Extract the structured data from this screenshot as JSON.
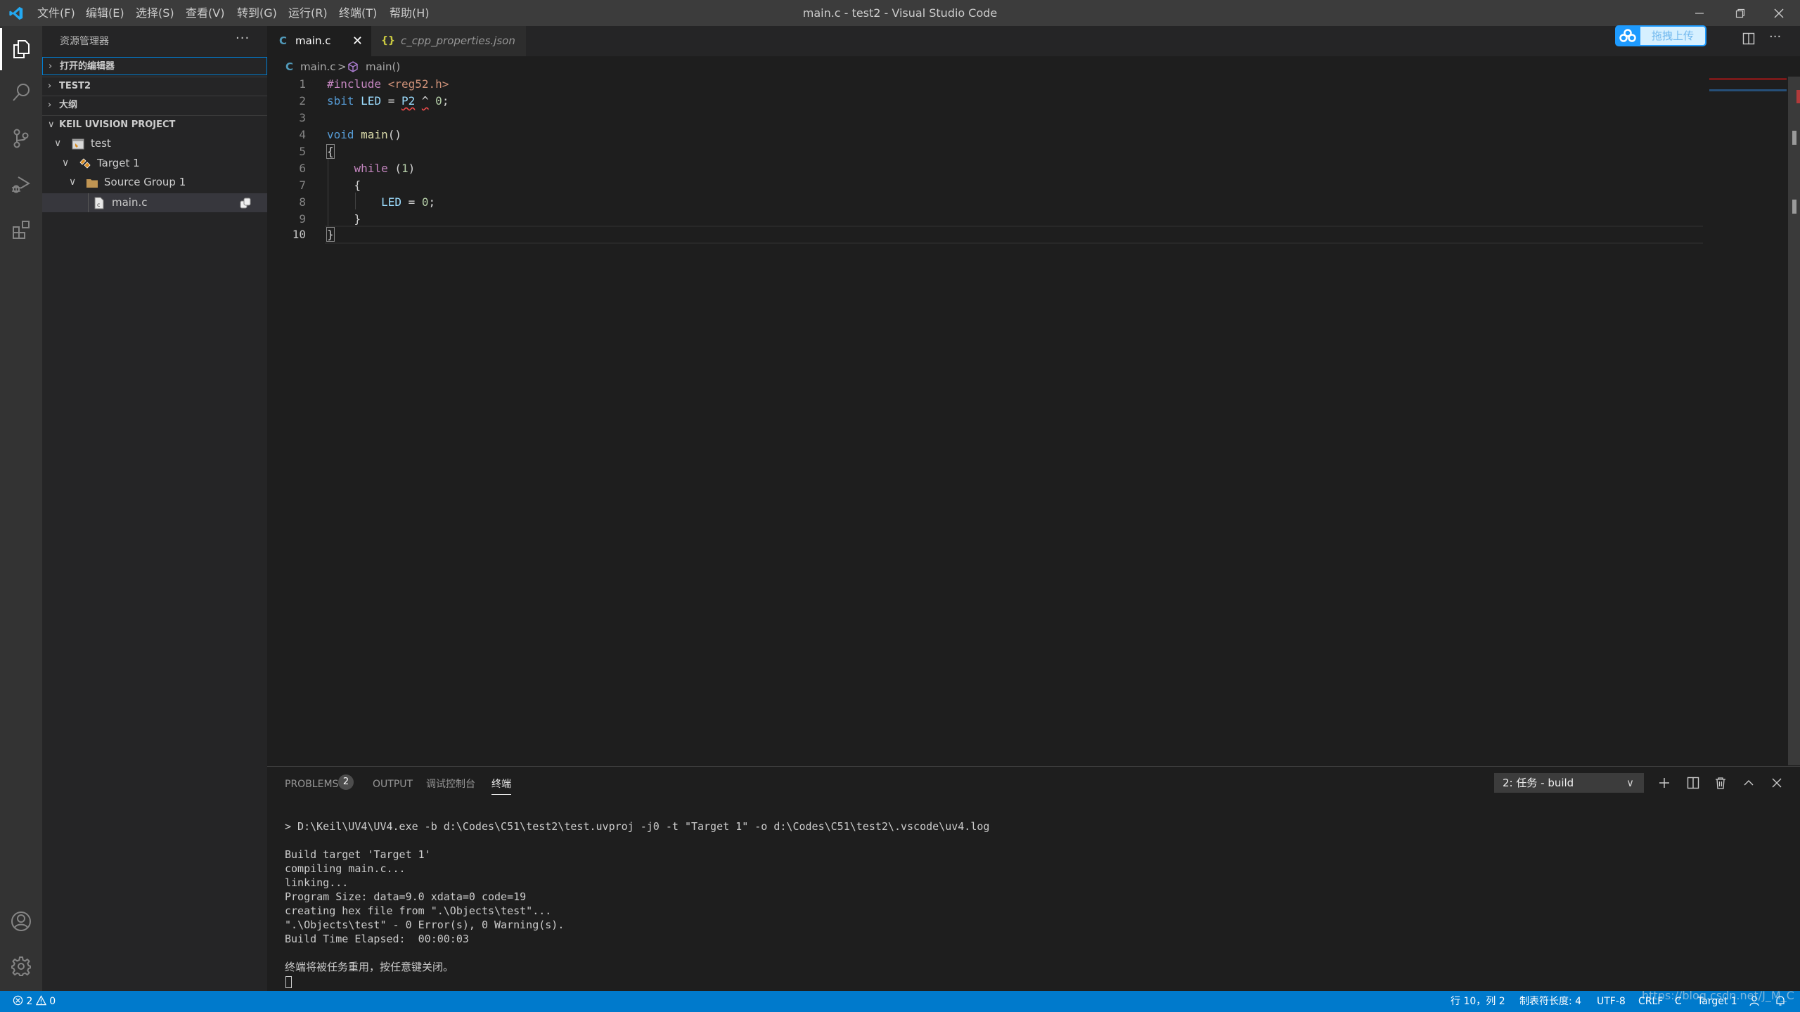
{
  "titlebar": {
    "title": "main.c - test2 - Visual Studio Code",
    "menu": [
      "文件(F)",
      "编辑(E)",
      "选择(S)",
      "查看(V)",
      "转到(G)",
      "运行(R)",
      "终端(T)",
      "帮助(H)"
    ]
  },
  "activitybar": {
    "items": [
      "explorer-icon",
      "search-icon",
      "source-control-icon",
      "run-debug-icon",
      "extensions-icon"
    ],
    "bottom": [
      "account-icon",
      "settings-gear-icon"
    ]
  },
  "sidebar": {
    "title": "资源管理器",
    "more": "···",
    "sections": [
      {
        "label": "打开的编辑器",
        "expanded": false
      },
      {
        "label": "TEST2",
        "expanded": false
      },
      {
        "label": "大纲",
        "expanded": false
      },
      {
        "label": "KEIL UVISION PROJECT",
        "expanded": true
      }
    ],
    "tree": [
      {
        "label": "test",
        "kind": "project"
      },
      {
        "label": "Target 1",
        "kind": "target"
      },
      {
        "label": "Source Group 1",
        "kind": "folder"
      },
      {
        "label": "main.c",
        "kind": "file",
        "selected": true
      }
    ]
  },
  "editor": {
    "tabs": [
      {
        "label": "main.c",
        "icon": "C",
        "active": true,
        "close": "✕"
      },
      {
        "label": "c_cpp_properties.json",
        "icon": "{}",
        "active": false
      }
    ],
    "upload_button": "拖拽上传",
    "breadcrumb": {
      "icon": "C",
      "file": "main.c",
      "separator": ">",
      "symbol": "main()"
    },
    "line_numbers": [
      "1",
      "2",
      "3",
      "4",
      "5",
      "6",
      "7",
      "8",
      "9",
      "10"
    ],
    "code": {
      "l1_directive": "#include",
      "l1_header": "<reg52.h>",
      "l2_type": "sbit",
      "l2_var": "LED",
      "l2_eq": " = ",
      "l2_p2": "P2",
      "l2_xor": "^",
      "l2_zero": "0",
      "l2_semi": ";",
      "l4_type": "void",
      "l4_fn": "main",
      "l4_paren": "()",
      "l5": "{",
      "l6_kw": "while",
      "l6_open": " (",
      "l6_num": "1",
      "l6_close": ")",
      "l7": "{",
      "l8_var": "LED",
      "l8_eq": " = ",
      "l8_num": "0",
      "l8_semi": ";",
      "l9": "}",
      "l10": "}"
    }
  },
  "panel": {
    "tabs": [
      {
        "label": "PROBLEMS",
        "badge": "2"
      },
      {
        "label": "OUTPUT"
      },
      {
        "label": "调试控制台"
      },
      {
        "label": "终端",
        "active": true
      }
    ],
    "terminal_select": "2: 任务 - build",
    "terminal_lines": [
      "> D:\\Keil\\UV4\\UV4.exe -b d:\\Codes\\C51\\test2\\test.uvproj -j0 -t \"Target 1\" -o d:\\Codes\\C51\\test2\\.vscode\\uv4.log",
      "",
      "Build target 'Target 1'",
      "compiling main.c...",
      "linking...",
      "Program Size: data=9.0 xdata=0 code=19",
      "creating hex file from \".\\Objects\\test\"...",
      "\".\\Objects\\test\" - 0 Error(s), 0 Warning(s).",
      "Build Time Elapsed:  00:00:03",
      "",
      "终端将被任务重用，按任意键关闭。"
    ]
  },
  "statusbar": {
    "errors": "2",
    "warnings": "0",
    "position": "行 10，列 2",
    "tab_size": "制表符长度: 4",
    "encoding": "UTF-8",
    "eol": "CRLF",
    "language": "C",
    "target": "Target 1"
  },
  "watermark": "https://blog.csdn.net/J_M_C",
  "colors": {
    "accent": "#007acc",
    "error": "#f14c4c",
    "folder": "#c09553"
  }
}
